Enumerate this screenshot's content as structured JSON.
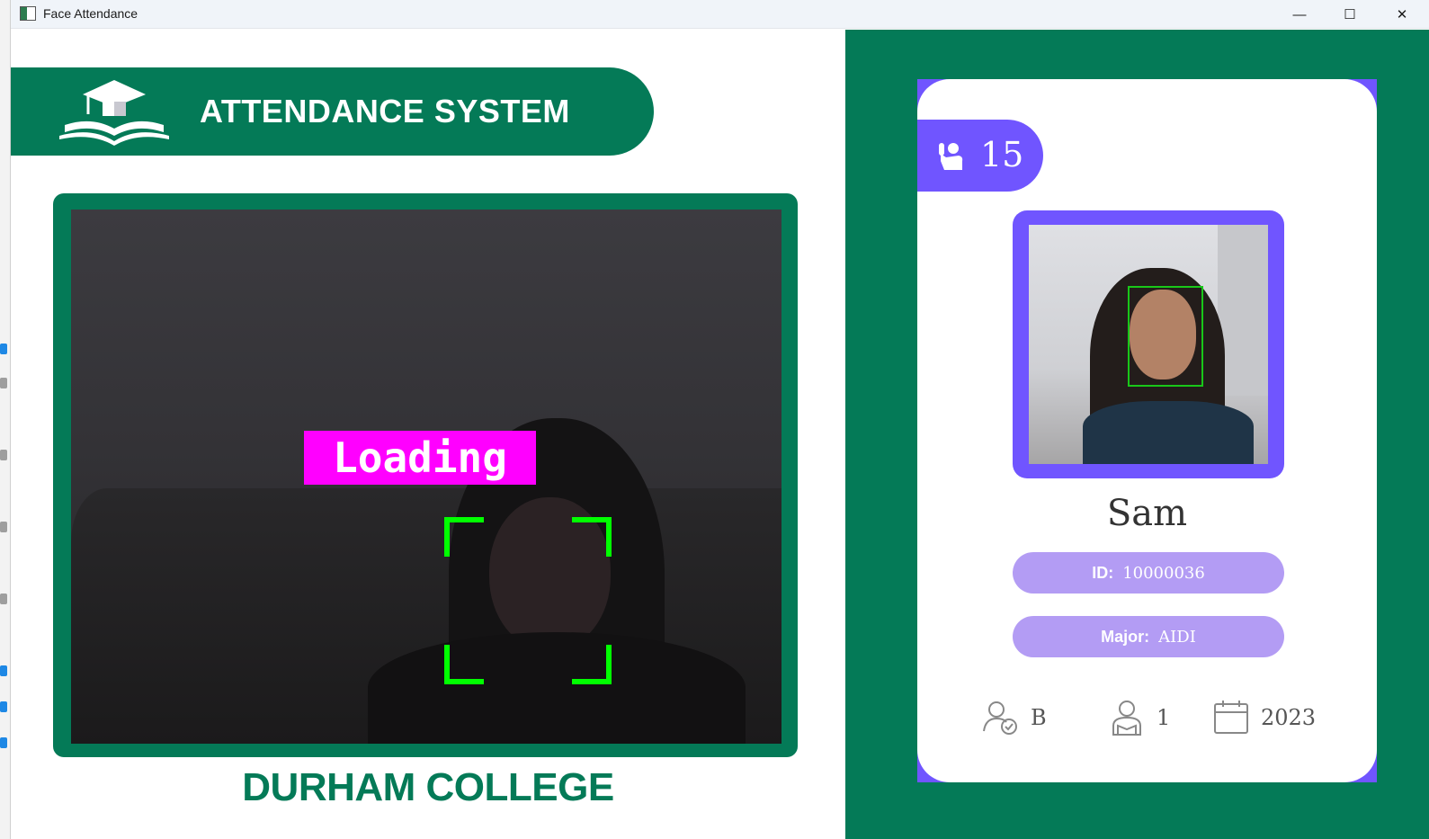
{
  "window": {
    "title": "Face Attendance",
    "controls": {
      "minimize": "—",
      "maximize": "☐",
      "close": "✕"
    }
  },
  "header": {
    "title": "ATTENDANCE SYSTEM",
    "logo_icon": "graduation-cap-book-icon"
  },
  "camera": {
    "status_label": "Loading",
    "status_color": "#ff00ff",
    "bracket_color": "#00ff00"
  },
  "footer": {
    "title": "DURHAM COLLEGE"
  },
  "student": {
    "total_attendance": "15",
    "attendance_icon": "raised-hand-icon",
    "name": "Sam",
    "id_label": "ID:",
    "id_value": "10000036",
    "major_label": "Major:",
    "major_value": "AIDI",
    "standing": "B",
    "standing_icon": "user-check-icon",
    "year": "1",
    "year_icon": "student-icon",
    "starting_year": "2023",
    "starting_year_icon": "calendar-icon"
  },
  "colors": {
    "brand_green": "#047a57",
    "accent_purple": "#7055ff",
    "pill_lavender": "#b39cf4",
    "face_box_green": "#19c719"
  }
}
